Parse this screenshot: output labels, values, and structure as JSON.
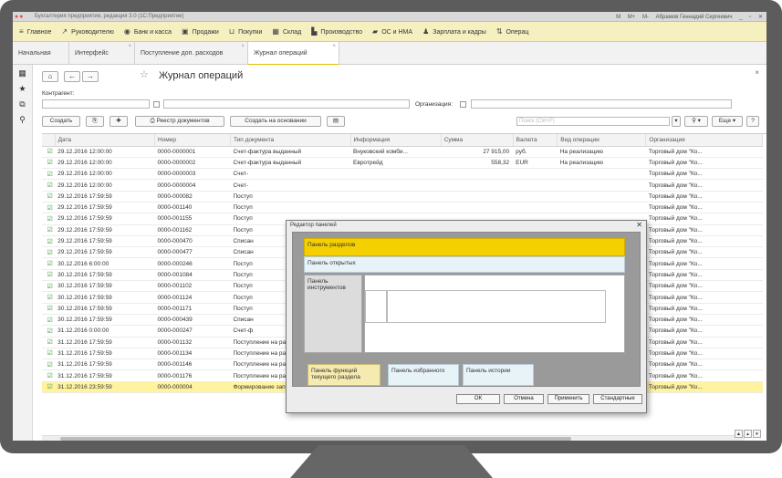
{
  "window": {
    "title": "Бухгалтерия предприятия, редакция 3.0 (1С:Предприятие)",
    "user": "Абрамов Геннадий Сергеевич",
    "toolbar_glyphs": [
      "M",
      "M+",
      "M-"
    ]
  },
  "menu": [
    {
      "icon": "hamburger-icon",
      "glyph": "≡",
      "label": "Главное"
    },
    {
      "icon": "chart-line-icon",
      "glyph": "↗",
      "label": "Руководителю"
    },
    {
      "icon": "bank-icon",
      "glyph": "◉",
      "label": "Банк и касса"
    },
    {
      "icon": "basket-icon",
      "glyph": "▣",
      "label": "Продажи"
    },
    {
      "icon": "cart-icon",
      "glyph": "⊔",
      "label": "Покупки"
    },
    {
      "icon": "warehouse-icon",
      "glyph": "▦",
      "label": "Склад"
    },
    {
      "icon": "factory-icon",
      "glyph": "▙",
      "label": "Производство"
    },
    {
      "icon": "truck-icon",
      "glyph": "▰",
      "label": "ОС и НМА"
    },
    {
      "icon": "person-icon",
      "glyph": "♟",
      "label": "Зарплата и кадры"
    },
    {
      "icon": "operations-icon",
      "glyph": "⇅",
      "label": "Операц"
    }
  ],
  "tabs": [
    {
      "label": "Начальная страница"
    },
    {
      "label": "Интерфейс"
    },
    {
      "label": "Поступление доп. расходов"
    },
    {
      "label": "Журнал операций"
    }
  ],
  "form": {
    "title": "Журнал операций",
    "kontragent_label": "Контрагент:",
    "organization_label": "Организация:",
    "search_placeholder": "Поиск (Ctrl+F)",
    "buttons": {
      "create": "Создать",
      "registry": "Реестр документов",
      "create_based": "Создать на основании",
      "more": "Еще",
      "help": "?"
    }
  },
  "table": {
    "columns": [
      "Дата",
      "Номер",
      "Тип документа",
      "Информация",
      "Сумма",
      "Валюта",
      "Вид операции",
      "Организация"
    ],
    "rows": [
      [
        "29.12.2016 12:00:00",
        "0000-0000001",
        "Счет-фактура выданный",
        "Внуковский комби...",
        "27 915,00",
        "руб.",
        "На реализацию",
        "Торговый дом \"Ко..."
      ],
      [
        "29.12.2016 12:00:00",
        "0000-0000002",
        "Счет-фактура выданный",
        "Евротрейд",
        "558,32",
        "EUR",
        "На реализацию",
        "Торговый дом \"Ко..."
      ],
      [
        "29.12.2016 12:00:00",
        "0000-0000003",
        "Счет-",
        "",
        "",
        "",
        "",
        "Торговый дом \"Ко..."
      ],
      [
        "29.12.2016 12:00:00",
        "0000-0000004",
        "Счет-",
        "",
        "",
        "",
        "",
        "Торговый дом \"Ко..."
      ],
      [
        "29.12.2016 17:59:59",
        "0000-000082",
        "Поступ",
        "",
        "",
        "",
        "",
        "Торговый дом \"Ко..."
      ],
      [
        "29.12.2016 17:59:59",
        "0000-001140",
        "Поступ",
        "",
        "",
        "",
        "",
        "Торговый дом \"Ко..."
      ],
      [
        "29.12.2016 17:59:59",
        "0000-001155",
        "Поступ",
        "",
        "",
        "",
        "",
        "Торговый дом \"Ко..."
      ],
      [
        "29.12.2016 17:59:59",
        "0000-001162",
        "Поступ",
        "",
        "",
        "",
        "",
        "Торговый дом \"Ко..."
      ],
      [
        "29.12.2016 17:59:59",
        "0000-000470",
        "Списан",
        "",
        "",
        "",
        "",
        "Торговый дом \"Ко..."
      ],
      [
        "29.12.2016 17:59:59",
        "0000-000477",
        "Списан",
        "",
        "",
        "",
        "",
        "Торговый дом \"Ко..."
      ],
      [
        "30.12.2016 6:00:00",
        "0000-000246",
        "Поступ",
        "",
        "",
        "",
        "",
        "Торговый дом \"Ко..."
      ],
      [
        "30.12.2016 17:59:59",
        "0000-001084",
        "Поступ",
        "",
        "",
        "",
        "",
        "Торговый дом \"Ко..."
      ],
      [
        "30.12.2016 17:59:59",
        "0000-001102",
        "Поступ",
        "",
        "",
        "",
        "",
        "Торговый дом \"Ко..."
      ],
      [
        "30.12.2016 17:59:59",
        "0000-001124",
        "Поступ",
        "",
        "",
        "",
        "",
        "Торговый дом \"Ко..."
      ],
      [
        "30.12.2016 17:59:59",
        "0000-001171",
        "Поступ",
        "",
        "",
        "",
        "",
        "Торговый дом \"Ко..."
      ],
      [
        "30.12.2016 17:59:59",
        "0000-000439",
        "Списан",
        "",
        "",
        "",
        "",
        "Торговый дом \"Ко..."
      ],
      [
        "31.12.2016 0:00:00",
        "0000-000247",
        "Счет-ф",
        "",
        "",
        "",
        "",
        "Торговый дом \"Ко..."
      ],
      [
        "31.12.2016 17:59:59",
        "0000-001132",
        "Поступление на расчетк...",
        "Никитаева И.В.",
        "22 567,50",
        "руб.",
        "Оплата от покупат...",
        "Торговый дом \"Ко..."
      ],
      [
        "31.12.2016 17:59:59",
        "0000-001134",
        "Поступление на расчетк...",
        "Кафе-кондитерска...",
        "110 636,25",
        "руб.",
        "Оплата от покупат...",
        "Торговый дом \"Ко..."
      ],
      [
        "31.12.2016 17:59:59",
        "0000-001146",
        "Поступление на расчетк...",
        "Авиатэк-Трейд",
        "102 135,00",
        "руб.",
        "Оплата от покупат...",
        "Торговый дом \"Ко..."
      ],
      [
        "31.12.2016 17:59:59",
        "0000-001176",
        "Поступление на расчетк...",
        "Кафе Аполлон",
        "51 607,50",
        "руб.",
        "",
        "Торговый дом \"Ко..."
      ],
      [
        "31.12.2016 23:59:59",
        "0000-000004",
        "Формирование записей ...",
        "",
        "",
        "",
        "",
        "Торговый дом \"Ко..."
      ]
    ]
  },
  "dialog": {
    "title": "Редактор панелей",
    "panels": {
      "sections": "Панель разделов",
      "open": "Панель открытых",
      "tools": "Панель инструментов",
      "functions": "Панель функций текущего раздела",
      "favorites": "Панель избранного",
      "history": "Панель истории"
    },
    "buttons": {
      "ok": "ОК",
      "cancel": "Отмена",
      "apply": "Применить",
      "standard": "Стандартные"
    }
  }
}
